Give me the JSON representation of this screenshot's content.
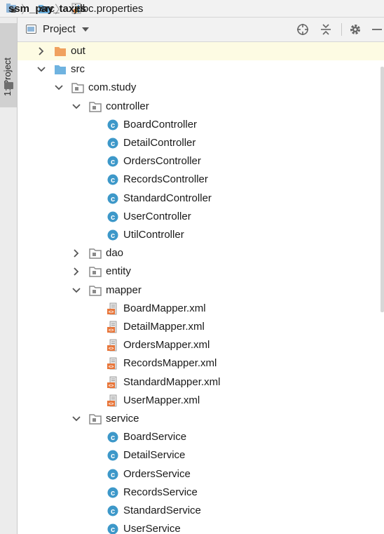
{
  "breadcrumb": [
    {
      "label": "ssm_pay_taxes",
      "icon": "project-module-icon",
      "bold": true
    },
    {
      "label": "src",
      "icon": "folder-icon",
      "bold": false
    },
    {
      "label": "jdbc.properties",
      "icon": "properties-file-icon",
      "bold": false
    }
  ],
  "side_panel": {
    "label": "1: Project"
  },
  "toolbar": {
    "view_label": "Project",
    "buttons": [
      {
        "name": "locate-button",
        "icon": "crosshair-icon"
      },
      {
        "name": "collapse-all-button",
        "icon": "collapse-icon"
      },
      {
        "name": "settings-button",
        "icon": "gear-icon"
      },
      {
        "name": "hide-button",
        "icon": "minimize-icon"
      }
    ]
  },
  "tree": [
    {
      "label": "out",
      "level": 0,
      "arrow": "collapsed",
      "icon": "folder-orange",
      "selected": true
    },
    {
      "label": "src",
      "level": 0,
      "arrow": "expanded",
      "icon": "folder-blue"
    },
    {
      "label": "com.study",
      "level": 1,
      "arrow": "expanded",
      "icon": "package"
    },
    {
      "label": "controller",
      "level": 2,
      "arrow": "expanded",
      "icon": "package"
    },
    {
      "label": "BoardController",
      "level": 3,
      "arrow": "none",
      "icon": "class"
    },
    {
      "label": "DetailController",
      "level": 3,
      "arrow": "none",
      "icon": "class"
    },
    {
      "label": "OrdersController",
      "level": 3,
      "arrow": "none",
      "icon": "class"
    },
    {
      "label": "RecordsController",
      "level": 3,
      "arrow": "none",
      "icon": "class"
    },
    {
      "label": "StandardController",
      "level": 3,
      "arrow": "none",
      "icon": "class"
    },
    {
      "label": "UserController",
      "level": 3,
      "arrow": "none",
      "icon": "class"
    },
    {
      "label": "UtilController",
      "level": 3,
      "arrow": "none",
      "icon": "class"
    },
    {
      "label": "dao",
      "level": 2,
      "arrow": "collapsed",
      "icon": "package"
    },
    {
      "label": "entity",
      "level": 2,
      "arrow": "collapsed",
      "icon": "package"
    },
    {
      "label": "mapper",
      "level": 2,
      "arrow": "expanded",
      "icon": "package"
    },
    {
      "label": "BoardMapper.xml",
      "level": 3,
      "arrow": "none",
      "icon": "xml"
    },
    {
      "label": "DetailMapper.xml",
      "level": 3,
      "arrow": "none",
      "icon": "xml"
    },
    {
      "label": "OrdersMapper.xml",
      "level": 3,
      "arrow": "none",
      "icon": "xml"
    },
    {
      "label": "RecordsMapper.xml",
      "level": 3,
      "arrow": "none",
      "icon": "xml"
    },
    {
      "label": "StandardMapper.xml",
      "level": 3,
      "arrow": "none",
      "icon": "xml"
    },
    {
      "label": "UserMapper.xml",
      "level": 3,
      "arrow": "none",
      "icon": "xml"
    },
    {
      "label": "service",
      "level": 2,
      "arrow": "expanded",
      "icon": "package"
    },
    {
      "label": "BoardService",
      "level": 3,
      "arrow": "none",
      "icon": "class"
    },
    {
      "label": "DetailService",
      "level": 3,
      "arrow": "none",
      "icon": "class"
    },
    {
      "label": "OrdersService",
      "level": 3,
      "arrow": "none",
      "icon": "class"
    },
    {
      "label": "RecordsService",
      "level": 3,
      "arrow": "none",
      "icon": "class"
    },
    {
      "label": "StandardService",
      "level": 3,
      "arrow": "none",
      "icon": "class"
    },
    {
      "label": "UserService",
      "level": 3,
      "arrow": "none",
      "icon": "class"
    }
  ],
  "colors": {
    "class_icon": "#3d98c9",
    "folder_blue": "#6fb3e0",
    "folder_orange": "#f0a15e",
    "package": "#8a8a8a",
    "xml_orange": "#e8763a",
    "selection": "#fdfbe3"
  }
}
